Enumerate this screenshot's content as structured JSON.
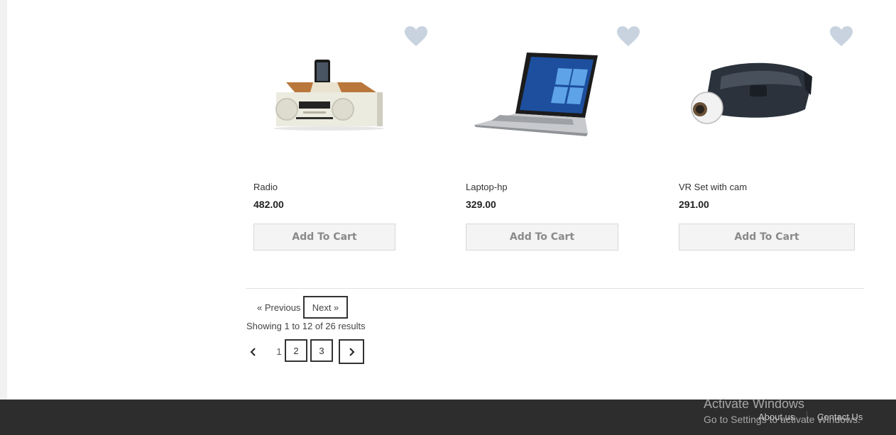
{
  "products": [
    {
      "name": "Radio",
      "price": "482.00",
      "cart_label": "Add To Cart"
    },
    {
      "name": "Laptop-hp",
      "price": "329.00",
      "cart_label": "Add To Cart"
    },
    {
      "name": "VR Set with cam",
      "price": "291.00",
      "cart_label": "Add To Cart"
    }
  ],
  "pager": {
    "previous_label": "« Previous",
    "next_label": "Next »",
    "results_text": "Showing 1 to 12 of 26 results",
    "pages": [
      "1",
      "2",
      "3"
    ],
    "current_page": "1"
  },
  "footer": {
    "about_label": "About us",
    "contact_label": "Contact Us"
  },
  "watermark": {
    "line1": "Activate Windows",
    "line2": "Go to Settings to activate Windows."
  },
  "icons": {
    "wishlist": "heart-icon",
    "prev_page": "chevron-left-icon",
    "next_page": "chevron-right-icon"
  },
  "colors": {
    "wishlist_heart": "#c8d3df",
    "footer_bg": "#2d2d2d",
    "button_bg": "#f4f4f4",
    "button_text": "#8a8a8a"
  }
}
